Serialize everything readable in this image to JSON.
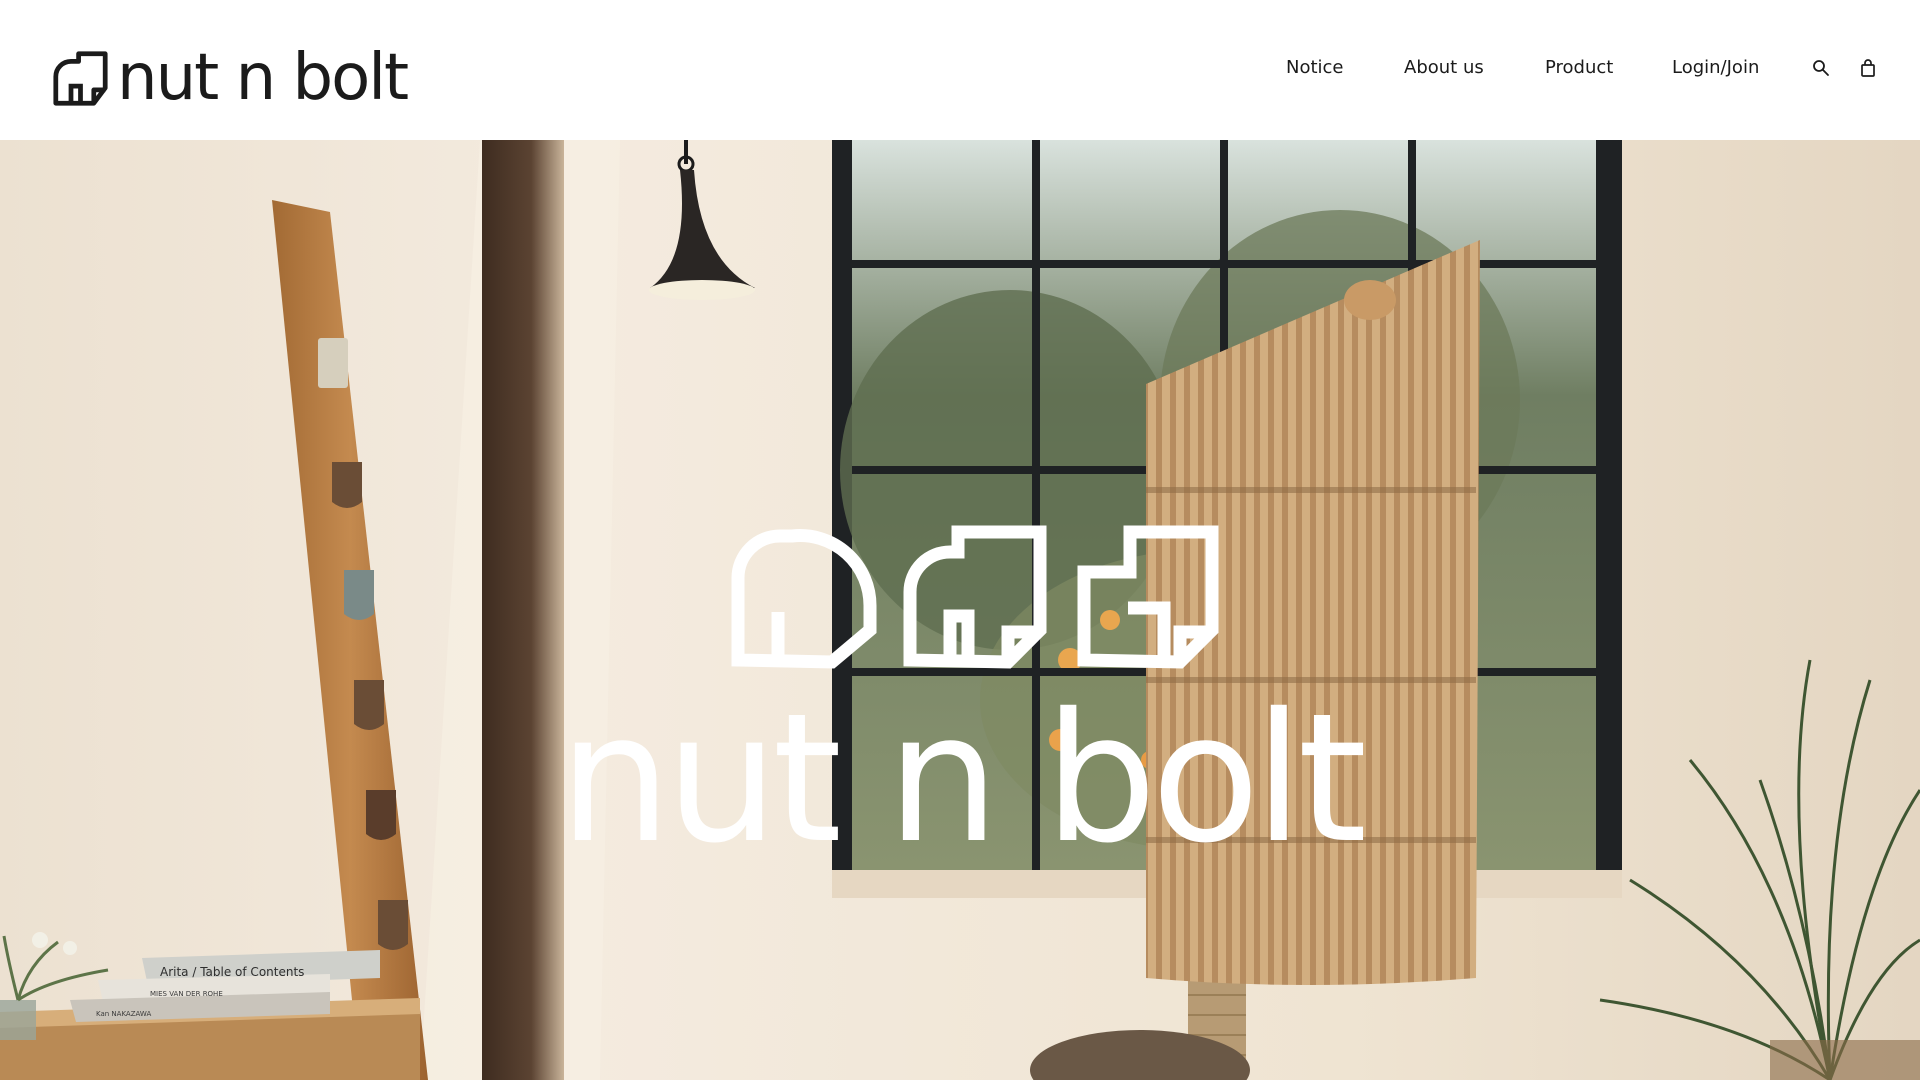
{
  "brand": {
    "name": "nut n bolt",
    "hero_wordmark": "nut n bolt"
  },
  "nav": {
    "items": [
      {
        "label": "Notice"
      },
      {
        "label": "About us"
      },
      {
        "label": "Product"
      },
      {
        "label": "Login/Join"
      }
    ],
    "icons": [
      "search-icon",
      "shopping-bag-icon"
    ]
  },
  "hero": {
    "book_titles": [
      "Arita / Table of Contents",
      "MIES VAN DER ROHE",
      "Kan NAKAZAWA"
    ]
  },
  "colors": {
    "text": "#1b1b1b",
    "header_bg": "#ffffff",
    "hero_overlay_text": "#ffffff"
  }
}
